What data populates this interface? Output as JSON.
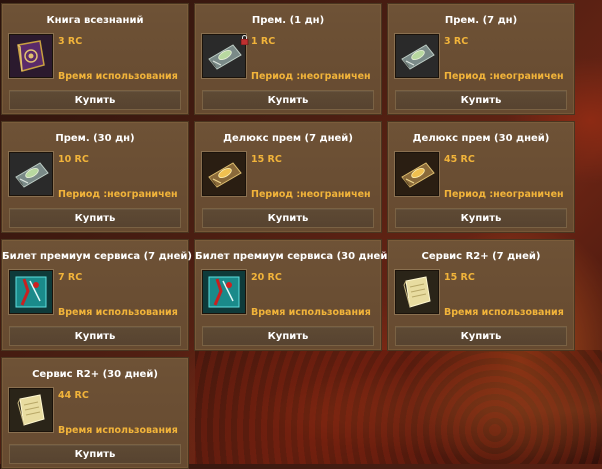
{
  "items": [
    {
      "title": "Книга всезнаний",
      "price": "3 RC",
      "period": "Время использования",
      "buy": "Купить",
      "icon": "purple-book-icon",
      "locked": false
    },
    {
      "title": "Прем. (1 дн)",
      "price": "1 RC",
      "period": "Период :неограничен",
      "buy": "Купить",
      "icon": "premium-scroll-icon",
      "locked": true
    },
    {
      "title": "Прем. (7 дн)",
      "price": "3 RC",
      "period": "Период :неограничен",
      "buy": "Купить",
      "icon": "premium-scroll-icon",
      "locked": false
    },
    {
      "title": "Прем. (30 дн)",
      "price": "10 RC",
      "period": "Период :неограничен",
      "buy": "Купить",
      "icon": "premium-scroll-icon",
      "locked": false
    },
    {
      "title": "Делюкс прем (7 дней)",
      "price": "15 RC",
      "period": "Период :неограничен",
      "buy": "Купить",
      "icon": "deluxe-scroll-icon",
      "locked": false
    },
    {
      "title": "Делюкс прем (30 дней)",
      "price": "45 RC",
      "period": "Период :неограничен",
      "buy": "Купить",
      "icon": "deluxe-scroll-icon",
      "locked": false
    },
    {
      "title": "Билет премиум сервиса  (7 дней)",
      "price": "7 RC",
      "period": "Время использования",
      "buy": "Купить",
      "icon": "service-ticket-icon",
      "locked": false
    },
    {
      "title": "Билет премиум сервиса  (30 дней)",
      "price": "20 RC",
      "period": "Время использования",
      "buy": "Купить",
      "icon": "service-ticket-icon",
      "locked": false
    },
    {
      "title": "Сервис R2+ (7 дней)",
      "price": "15 RC",
      "period": "Время использования",
      "buy": "Купить",
      "icon": "r2-service-scroll-icon",
      "locked": false
    },
    {
      "title": "Сервис R2+ (30 дней)",
      "price": "44 RC",
      "period": "Время использования",
      "buy": "Купить",
      "icon": "r2-service-scroll-icon",
      "locked": false
    }
  ],
  "colors": {
    "price": "#f2b43a",
    "card": "#6e5236",
    "button": "#5e4a34"
  }
}
